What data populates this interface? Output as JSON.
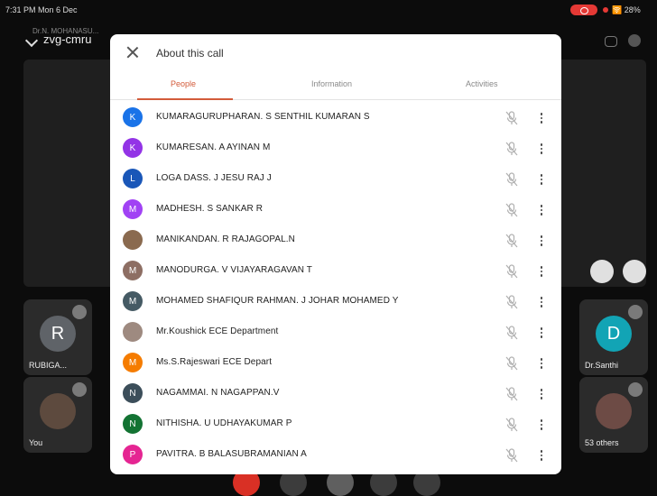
{
  "status_bar": {
    "time": "7:31 PM  Mon 6 Dec",
    "right": "🛜 28% "
  },
  "meeting": {
    "code": "zvg-cmru",
    "host_label": "Dr.N. MOHANASU..."
  },
  "tiles": {
    "left_top": {
      "initial": "R",
      "label": "RUBIGA...",
      "color": "#5f6368"
    },
    "left_bottom": {
      "label": "You"
    },
    "right_top": {
      "initial": "D",
      "label": "Dr.Santhi",
      "color": "#12a4b5"
    },
    "right_bottom": {
      "label": "53 others"
    }
  },
  "dialog": {
    "title": "About this call",
    "tabs": [
      "People",
      "Information",
      "Activities"
    ],
    "active_tab": "People",
    "accent": "#d35b3a",
    "participants": [
      {
        "name": "KUMARAGURUPHARAN. S SENTHIL KUMARAN S",
        "initial": "K",
        "color": "#1a73e8"
      },
      {
        "name": "KUMARESAN. A AYINAN M",
        "initial": "K",
        "color": "#9334e6"
      },
      {
        "name": "LOGA DASS. J JESU RAJ J",
        "initial": "L",
        "color": "#1a57b8"
      },
      {
        "name": "MADHESH. S SANKAR R",
        "initial": "M",
        "color": "#a142f4"
      },
      {
        "name": "MANIKANDAN. R RAJAGOPAL.N",
        "initial": "",
        "color": "#8a6a4f"
      },
      {
        "name": "MANODURGA. V VIJAYARAGAVAN T",
        "initial": "M",
        "color": "#8d6e63"
      },
      {
        "name": "MOHAMED SHAFIQUR RAHMAN. J JOHAR MOHAMED Y",
        "initial": "M",
        "color": "#455a64"
      },
      {
        "name": "Mr.Koushick ECE Department",
        "initial": "",
        "color": "#9e8a80"
      },
      {
        "name": "Ms.S.Rajeswari ECE Depart",
        "initial": "M",
        "color": "#f57c00"
      },
      {
        "name": "NAGAMMAI. N NAGAPPAN.V",
        "initial": "N",
        "color": "#3c4e5a"
      },
      {
        "name": "NITHISHA. U UDHAYAKUMAR P",
        "initial": "N",
        "color": "#137333"
      },
      {
        "name": "PAVITRA. B BALASUBRAMANIAN A",
        "initial": "P",
        "color": "#e52592"
      }
    ]
  }
}
